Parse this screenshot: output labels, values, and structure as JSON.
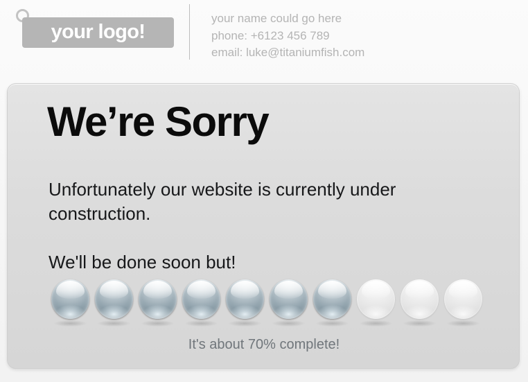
{
  "header": {
    "logo": {
      "text": "your logo!",
      "ring_icon": "ring-hole-icon"
    },
    "contact": {
      "name": "your name could go here",
      "phone": "phone: +6123 456 789",
      "email": "email: luke@titaniumfish.com"
    }
  },
  "panel": {
    "title": "We’re Sorry",
    "paragraph": "Unfortunately our website is currently under construction.",
    "paragraph2": "We'll be done soon but!",
    "progress": {
      "caption": "It's about 70% complete!",
      "percent": 70,
      "total_orbs": 10,
      "filled_orbs": 7,
      "orbs": [
        {
          "state": "filled"
        },
        {
          "state": "filled"
        },
        {
          "state": "filled"
        },
        {
          "state": "filled"
        },
        {
          "state": "filled"
        },
        {
          "state": "filled"
        },
        {
          "state": "filled"
        },
        {
          "state": "empty"
        },
        {
          "state": "empty"
        },
        {
          "state": "empty"
        }
      ]
    }
  },
  "colors": {
    "logo_plate": "#b5b5b5",
    "logo_text": "#ffffff",
    "contact_text": "#b4b4b4",
    "title_text": "#0b0b0b",
    "body_text": "#17181a",
    "caption_text": "#70767b",
    "panel_bg": "#dcdcdc",
    "page_bg": "#f6f6f6",
    "orb_filled": "#5d737f",
    "orb_empty": "#e2e2e2"
  }
}
